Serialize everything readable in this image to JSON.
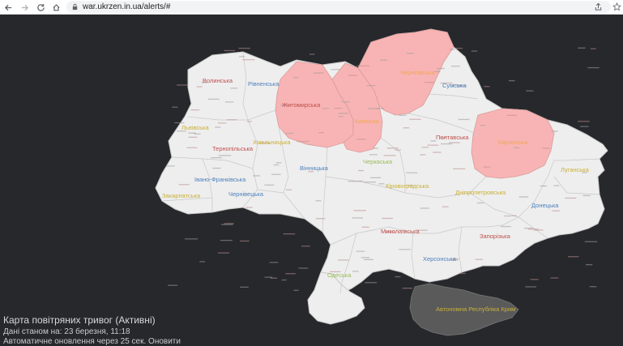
{
  "browser": {
    "url": "war.ukrzen.in.ua/alerts/#",
    "nav_icons": [
      "back-icon",
      "forward-icon",
      "reload-icon",
      "home-icon"
    ],
    "addr_icons": [
      "share-icon",
      "bookmark-star-icon"
    ]
  },
  "map": {
    "title": "Карта повітряних тривог (Активні)",
    "date_line": "Дані станом на: 23 березня, 11:18",
    "update_line": "Автоматичне оновлення через 25 сек. Оновити",
    "colors": {
      "background": "#26282b",
      "region_fill": "#eeeeee",
      "alert_fill": "#f8b4b4",
      "crimea_fill": "#5a5a5a",
      "border": "#c8c8c8"
    },
    "regions": [
      {
        "id": "volynska",
        "label": "Волинська",
        "alert": false,
        "color": "#c0504d"
      },
      {
        "id": "rivnenska",
        "label": "Рівненська",
        "alert": false,
        "color": "#4f81bd"
      },
      {
        "id": "zhytomyrska",
        "label": "Житомирська",
        "alert": true,
        "color": "#c0504d"
      },
      {
        "id": "kyivska",
        "label": "Київська",
        "alert": true,
        "color": "#f0a858"
      },
      {
        "id": "chernihivska",
        "label": "Чернігівська",
        "alert": true,
        "color": "#f0a858"
      },
      {
        "id": "sumska",
        "label": "Сумська",
        "alert": false,
        "color": "#4f81bd"
      },
      {
        "id": "kharkivska",
        "label": "Харківська",
        "alert": true,
        "color": "#f0a858"
      },
      {
        "id": "luhanska",
        "label": "Луганська",
        "alert": false,
        "color": "#c9b038"
      },
      {
        "id": "lvivska",
        "label": "Львівська",
        "alert": false,
        "color": "#c9b038"
      },
      {
        "id": "ternopilska",
        "label": "Тернопільська",
        "alert": false,
        "color": "#c0504d"
      },
      {
        "id": "khmelnytska",
        "label": "Хмельницька",
        "alert": false,
        "color": "#c9b038"
      },
      {
        "id": "vinnytska",
        "label": "Вінницька",
        "alert": false,
        "color": "#4f81bd"
      },
      {
        "id": "cherkaska",
        "label": "Черкаська",
        "alert": false,
        "color": "#9bbb59"
      },
      {
        "id": "poltavska",
        "label": "Полтавська",
        "alert": false,
        "color": "#c0504d"
      },
      {
        "id": "ivano",
        "label": "Івано-Франківська",
        "alert": false,
        "color": "#4f81bd"
      },
      {
        "id": "zakarpatska",
        "label": "Закарпатська",
        "alert": false,
        "color": "#c9b038"
      },
      {
        "id": "chernivetska",
        "label": "Чернівецька",
        "alert": false,
        "color": "#4f81bd"
      },
      {
        "id": "kirovohradska",
        "label": "Кіровоградська",
        "alert": false,
        "color": "#c9b038"
      },
      {
        "id": "dnipro",
        "label": "Дніпропетровська",
        "alert": false,
        "color": "#c9b038"
      },
      {
        "id": "donetska",
        "label": "Донецька",
        "alert": false,
        "color": "#4f81bd"
      },
      {
        "id": "mykolaivska",
        "label": "Миколаївська",
        "alert": false,
        "color": "#c0504d"
      },
      {
        "id": "zaporizka",
        "label": "Запорізька",
        "alert": false,
        "color": "#c0504d"
      },
      {
        "id": "odeska",
        "label": "Одеська",
        "alert": false,
        "color": "#9bbb59"
      },
      {
        "id": "khersonska",
        "label": "Херсонська",
        "alert": false,
        "color": "#4f81bd"
      },
      {
        "id": "crimea",
        "label": "Автономна Республіка Крим",
        "alert": false,
        "color": "#c9b038"
      }
    ]
  }
}
